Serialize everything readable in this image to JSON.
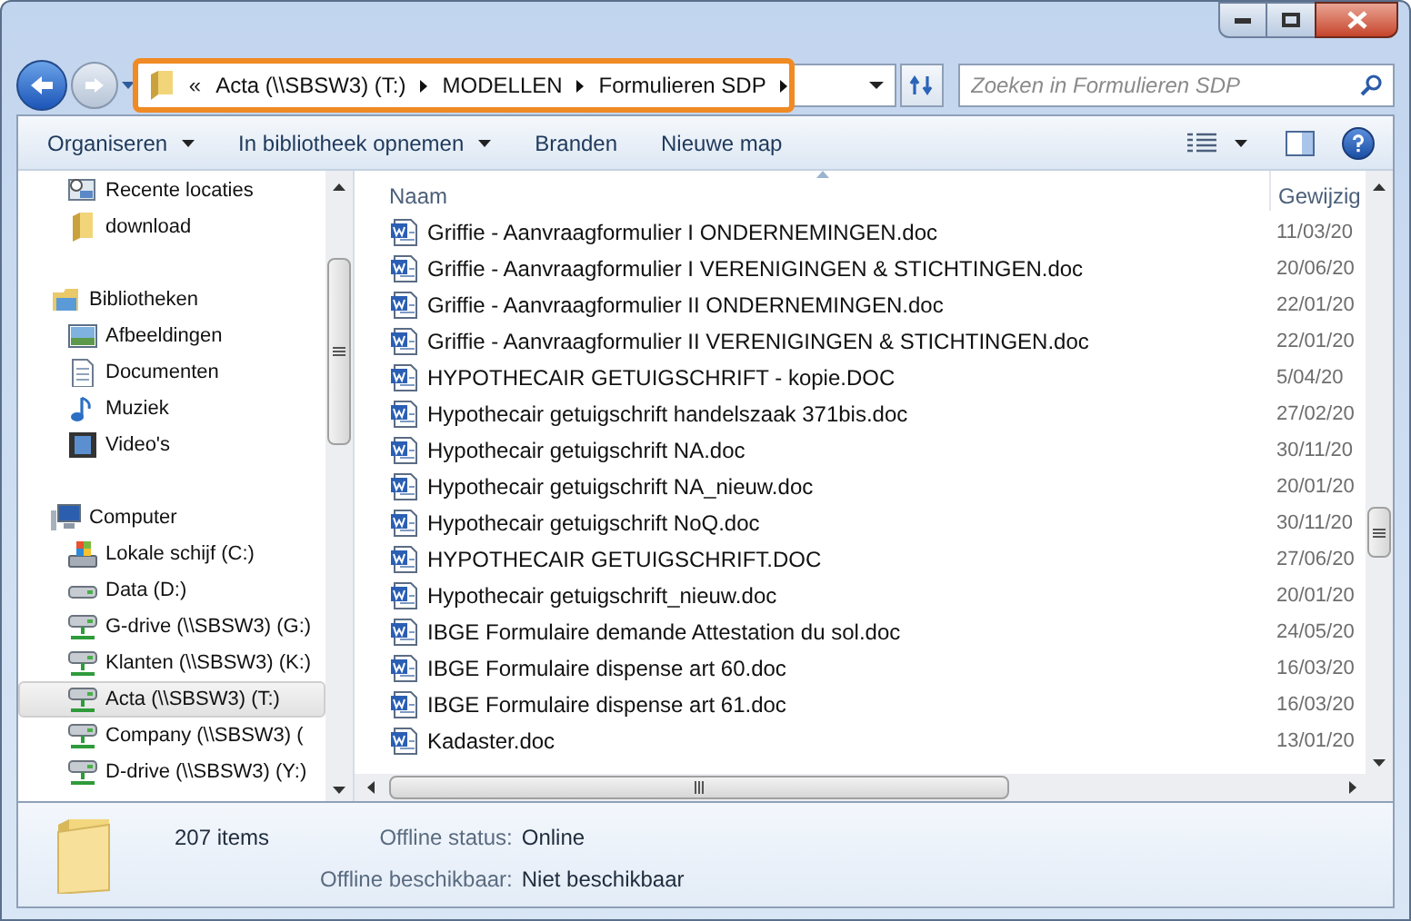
{
  "address": {
    "overflow": "«",
    "crumbs": [
      "Acta (\\\\SBSW3) (T:)",
      "MODELLEN",
      "Formulieren SDP"
    ]
  },
  "search": {
    "placeholder": "Zoeken in Formulieren SDP"
  },
  "toolbar": [
    {
      "label": "Organiseren",
      "kind": "menu"
    },
    {
      "label": "In bibliotheek opnemen",
      "kind": "menu"
    },
    {
      "label": "Branden",
      "kind": "plain"
    },
    {
      "label": "Nieuwe map",
      "kind": "plain"
    }
  ],
  "nav": [
    {
      "items": [
        {
          "label": "Recente locaties",
          "kind": "recent",
          "selected": false
        },
        {
          "label": "download",
          "kind": "folder",
          "selected": false
        }
      ]
    },
    {
      "label": "Bibliotheken",
      "kind": "library",
      "items": [
        {
          "label": "Afbeeldingen",
          "kind": "pictures",
          "selected": false
        },
        {
          "label": "Documenten",
          "kind": "documents",
          "selected": false
        },
        {
          "label": "Muziek",
          "kind": "music",
          "selected": false
        },
        {
          "label": "Video's",
          "kind": "video",
          "selected": false
        }
      ]
    },
    {
      "label": "Computer",
      "kind": "computer",
      "items": [
        {
          "label": "Lokale schijf (C:)",
          "kind": "system-drive",
          "selected": false
        },
        {
          "label": "Data (D:)",
          "kind": "drive",
          "selected": false
        },
        {
          "label": "G-drive (\\\\SBSW3) (G:)",
          "kind": "network-drive",
          "selected": false
        },
        {
          "label": "Klanten (\\\\SBSW3) (K:)",
          "kind": "network-drive",
          "selected": false
        },
        {
          "label": "Acta (\\\\SBSW3) (T:)",
          "kind": "network-drive",
          "selected": true
        },
        {
          "label": "Company (\\\\SBSW3) (",
          "kind": "network-drive",
          "selected": false
        },
        {
          "label": "D-drive (\\\\SBSW3) (Y:)",
          "kind": "network-drive",
          "selected": false
        }
      ]
    }
  ],
  "columns": [
    "Naam",
    "Gewijzig"
  ],
  "files": [
    {
      "name": "Griffie - Aanvraagformulier I ONDERNEMINGEN.doc",
      "date": "11/03/20"
    },
    {
      "name": "Griffie - Aanvraagformulier I VERENIGINGEN & STICHTINGEN.doc",
      "date": "20/06/20"
    },
    {
      "name": "Griffie - Aanvraagformulier II ONDERNEMINGEN.doc",
      "date": "22/01/20"
    },
    {
      "name": "Griffie - Aanvraagformulier II VERENIGINGEN & STICHTINGEN.doc",
      "date": "22/01/20"
    },
    {
      "name": "HYPOTHECAIR GETUIGSCHRIFT - kopie.DOC",
      "date": "5/04/20"
    },
    {
      "name": "Hypothecair getuigschrift handelszaak 371bis.doc",
      "date": "27/02/20"
    },
    {
      "name": "Hypothecair getuigschrift NA.doc",
      "date": "30/11/20"
    },
    {
      "name": "Hypothecair getuigschrift NA_nieuw.doc",
      "date": "20/01/20"
    },
    {
      "name": "Hypothecair getuigschrift NoQ.doc",
      "date": "30/11/20"
    },
    {
      "name": "HYPOTHECAIR GETUIGSCHRIFT.DOC",
      "date": "27/06/20"
    },
    {
      "name": "Hypothecair getuigschrift_nieuw.doc",
      "date": "20/01/20"
    },
    {
      "name": "IBGE Formulaire demande Attestation du sol.doc",
      "date": "24/05/20"
    },
    {
      "name": "IBGE Formulaire dispense art 60.doc",
      "date": "16/03/20"
    },
    {
      "name": "IBGE Formulaire dispense art 61.doc",
      "date": "16/03/20"
    },
    {
      "name": "Kadaster.doc",
      "date": "13/01/20"
    }
  ],
  "details": {
    "count": "207 items",
    "fields": [
      {
        "label": "Offline status:",
        "value": "Online"
      },
      {
        "label": "Offline beschikbaar:",
        "value": "Niet beschikbaar"
      }
    ]
  }
}
